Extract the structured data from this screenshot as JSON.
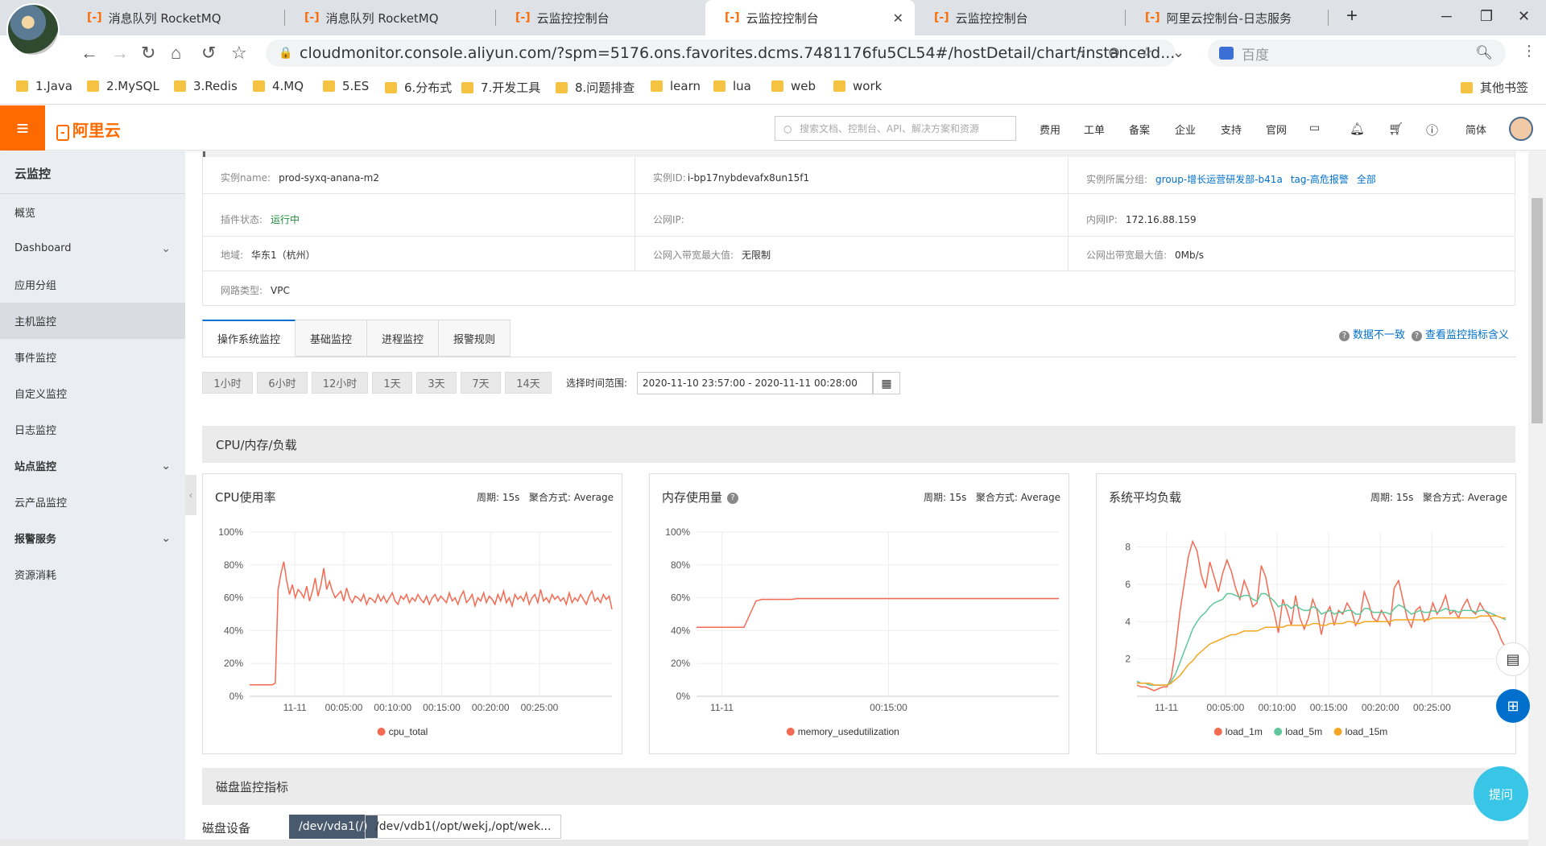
{
  "browser": {
    "tabs": [
      {
        "label": "消息队列 RocketMQ"
      },
      {
        "label": "消息队列 RocketMQ"
      },
      {
        "label": "云监控控制台"
      },
      {
        "label": "云监控控制台"
      },
      {
        "label": "云监控控制台"
      },
      {
        "label": "阿里云控制台-日志服务"
      }
    ],
    "new_tab": "+",
    "url": "cloudmonitor.console.aliyun.com/?spm=5176.ons.favorites.dcms.7481176fu5CL54#/hostDetail/chart/instanceId...",
    "search_placeholder": "百度",
    "bookmarks": [
      "1.Java",
      "2.MySQL",
      "3.Redis",
      "4.MQ",
      "5.ES",
      "6.分布式",
      "7.开发工具",
      "8.问题排查",
      "learn",
      "lua",
      "web",
      "work"
    ],
    "other_bookmarks": "其他书签"
  },
  "console": {
    "logo": "阿里云",
    "search_placeholder": "搜索文档、控制台、API、解决方案和资源",
    "nav": [
      "费用",
      "工单",
      "备案",
      "企业",
      "支持",
      "官网"
    ],
    "lang": "简体"
  },
  "sidebar": {
    "title": "云监控",
    "items": [
      {
        "label": "概览"
      },
      {
        "label": "Dashboard"
      },
      {
        "label": "应用分组"
      },
      {
        "label": "主机监控"
      },
      {
        "label": "事件监控"
      },
      {
        "label": "自定义监控"
      },
      {
        "label": "日志监控"
      },
      {
        "label": "站点监控"
      },
      {
        "label": "云产品监控"
      },
      {
        "label": "报警服务"
      },
      {
        "label": "资源消耗"
      }
    ]
  },
  "instance": {
    "name_key": "实例name:",
    "name": "prod-syxq-anana-m2",
    "id_key": "实例ID:",
    "id": "i-bp17nybdevafx8un15f1",
    "group_key": "实例所属分组:",
    "group1": "group-增长运营研发部-b41a",
    "group2": "tag-高危报警",
    "group_all": "全部",
    "agent_key": "插件状态:",
    "agent": "运行中",
    "pubip_key": "公网IP:",
    "privip_key": "内网IP:",
    "privip": "172.16.88.159",
    "region_key": "地域:",
    "region": "华东1（杭州）",
    "inbw_key": "公网入带宽最大值:",
    "inbw": "无限制",
    "outbw_key": "公网出带宽最大值:",
    "outbw": "0Mb/s",
    "net_key": "网路类型:",
    "net": "VPC"
  },
  "tabs": [
    "操作系统监控",
    "基础监控",
    "进程监控",
    "报警规则"
  ],
  "help_links": [
    "数据不一致",
    "查看监控指标含义"
  ],
  "time_buttons": [
    "1小时",
    "6小时",
    "12小时",
    "1天",
    "3天",
    "7天",
    "14天"
  ],
  "range_label": "选择时间范围:",
  "range_value": "2020-11-10 23:57:00 - 2020-11-11 00:28:00",
  "section_cpu": "CPU/内存/负载",
  "section_disk": "磁盘监控指标",
  "disk_label": "磁盘设备",
  "disk_tabs": [
    "/dev/vda1(/)",
    "/dev/vdb1(/opt/wekj,/opt/wek..."
  ],
  "float_ask": "提问",
  "colors": {
    "red": "#f46a52",
    "green": "#5fc79a",
    "orange": "#f5a623",
    "accent": "#ff6a00",
    "link": "#0070cc"
  },
  "chart_data": [
    {
      "type": "line",
      "title": "CPU使用率",
      "period": "周期: 15s",
      "agg": "聚合方式: Average",
      "y_ticks": [
        "100%",
        "80%",
        "60%",
        "40%",
        "20%",
        "0%"
      ],
      "x_ticks": [
        "11-11",
        "00:05:00",
        "00:10:00",
        "00:15:00",
        "00:20:00",
        "00:25:00"
      ],
      "ylim": [
        0,
        100
      ],
      "series": [
        {
          "name": "cpu_total",
          "color": "#f46a52",
          "values": [
            7,
            7,
            7,
            7,
            7,
            7,
            7,
            7,
            7,
            8,
            65,
            75,
            82,
            70,
            62,
            68,
            60,
            65,
            63,
            60,
            67,
            58,
            64,
            72,
            61,
            68,
            78,
            65,
            70,
            64,
            60,
            62,
            64,
            58,
            66,
            60,
            57,
            61,
            60,
            58,
            62,
            56,
            60,
            59,
            57,
            62,
            58,
            61,
            57,
            60,
            63,
            58,
            56,
            61,
            59,
            62,
            57,
            60,
            58,
            62,
            59,
            57,
            61,
            56,
            60,
            62,
            58,
            61,
            59,
            57,
            63,
            58,
            60,
            56,
            61,
            64,
            57,
            59,
            62,
            55,
            60,
            58,
            63,
            57,
            61,
            59,
            56,
            62,
            58,
            64,
            57,
            60,
            55,
            62,
            59,
            61,
            58,
            63,
            56,
            60,
            62,
            57,
            65,
            58,
            60,
            57,
            62,
            59,
            61,
            58,
            60,
            56,
            63,
            57,
            60,
            58,
            62,
            59,
            56,
            61,
            64,
            58,
            60,
            57,
            62,
            59,
            61,
            53
          ]
        }
      ]
    },
    {
      "type": "line",
      "title": "内存使用量",
      "period": "周期: 15s",
      "agg": "聚合方式: Average",
      "y_ticks": [
        "100%",
        "80%",
        "60%",
        "40%",
        "20%",
        "0%"
      ],
      "x_ticks": [
        "11-11",
        "00:15:00"
      ],
      "ylim": [
        0,
        100
      ],
      "series": [
        {
          "name": "memory_usedutilization",
          "color": "#f46a52",
          "values": [
            42,
            42,
            42,
            42,
            42,
            42,
            42,
            42,
            42,
            50,
            58,
            59,
            59,
            59,
            59,
            59,
            59,
            59.5,
            59.5,
            59.5,
            59.5,
            59.5,
            59.5,
            59.5,
            59.5,
            59.5,
            59.5,
            59.5,
            59.5,
            59.5,
            59.5,
            59.5,
            59.5,
            59.5,
            59.5,
            59.5,
            59.5,
            59.5,
            59.5,
            59.5,
            59.5,
            59.5,
            59.5,
            59.5,
            59.5,
            59.5,
            59.5,
            59.5,
            59.5,
            59.5,
            59.5,
            59.5,
            59.5,
            59.5,
            59.5,
            59.5,
            59.5,
            59.5,
            59.5,
            59.5,
            59.5,
            59.5
          ]
        }
      ]
    },
    {
      "type": "line",
      "title": "系统平均负载",
      "period": "周期: 15s",
      "agg": "聚合方式: Average",
      "y_ticks": [
        "8",
        "6",
        "4",
        "2"
      ],
      "x_ticks": [
        "11-11",
        "00:05:00",
        "00:10:00",
        "00:15:00",
        "00:20:00",
        "00:25:00"
      ],
      "ylim": [
        0,
        8.8
      ],
      "series": [
        {
          "name": "load_1m",
          "color": "#f46a52",
          "values": [
            0.6,
            0.5,
            0.5,
            0.4,
            0.3,
            0.4,
            0.5,
            0.5,
            1.0,
            2.5,
            4.5,
            6.0,
            7.5,
            8.3,
            7.8,
            6.5,
            5.8,
            7.2,
            6.4,
            5.6,
            6.6,
            7.3,
            6.7,
            5.8,
            5.2,
            6.2,
            5.6,
            4.8,
            5.0,
            7.0,
            6.4,
            5.2,
            4.5,
            3.4,
            5.2,
            4.6,
            3.8,
            5.4,
            4.2,
            3.6,
            4.2,
            5.2,
            4.6,
            3.3,
            4.4,
            4.8,
            3.8,
            4.6,
            4.4,
            5.0,
            4.6,
            3.8,
            4.2,
            5.6,
            5.0,
            4.2,
            4.0,
            4.6,
            4.2,
            3.8,
            5.8,
            6.2,
            5.2,
            4.2,
            3.7,
            4.6,
            4.8,
            4.0,
            4.2,
            5.0,
            4.4,
            4.8,
            5.4,
            4.4,
            4.6,
            4.2,
            4.8,
            5.2,
            4.6,
            4.4,
            5.0,
            4.6,
            4.4,
            4.0,
            3.6,
            3.0,
            2.6
          ]
        },
        {
          "name": "load_5m",
          "color": "#5fc79a",
          "values": [
            0.8,
            0.7,
            0.7,
            0.6,
            0.6,
            0.6,
            0.6,
            0.6,
            0.8,
            1.2,
            1.8,
            2.4,
            3.0,
            3.6,
            4.0,
            4.3,
            4.5,
            4.8,
            5.0,
            5.1,
            5.2,
            5.5,
            5.5,
            5.4,
            5.3,
            5.4,
            5.4,
            5.2,
            5.1,
            5.5,
            5.5,
            5.3,
            5.1,
            4.8,
            4.9,
            4.9,
            4.7,
            4.9,
            4.7,
            4.6,
            4.6,
            4.8,
            4.7,
            4.4,
            4.5,
            4.6,
            4.4,
            4.5,
            4.5,
            4.6,
            4.6,
            4.4,
            4.4,
            4.7,
            4.7,
            4.5,
            4.5,
            4.5,
            4.5,
            4.4,
            4.7,
            4.9,
            4.8,
            4.6,
            4.4,
            4.5,
            4.6,
            4.5,
            4.5,
            4.6,
            4.5,
            4.6,
            4.7,
            4.6,
            4.6,
            4.5,
            4.6,
            4.6,
            4.6,
            4.5,
            4.6,
            4.6,
            4.5,
            4.4,
            4.3,
            4.2,
            4.1
          ]
        },
        {
          "name": "load_15m",
          "color": "#f5a623",
          "values": [
            0.7,
            0.7,
            0.7,
            0.7,
            0.6,
            0.6,
            0.6,
            0.6,
            0.7,
            0.9,
            1.1,
            1.4,
            1.7,
            1.9,
            2.2,
            2.4,
            2.6,
            2.8,
            2.9,
            3.0,
            3.1,
            3.2,
            3.3,
            3.3,
            3.4,
            3.5,
            3.5,
            3.5,
            3.5,
            3.6,
            3.7,
            3.7,
            3.7,
            3.7,
            3.7,
            3.8,
            3.8,
            3.8,
            3.8,
            3.8,
            3.8,
            3.9,
            3.9,
            3.8,
            3.8,
            3.9,
            3.9,
            3.9,
            3.9,
            4.0,
            4.0,
            3.9,
            3.9,
            4.0,
            4.0,
            4.0,
            4.0,
            4.0,
            4.0,
            4.0,
            4.1,
            4.1,
            4.1,
            4.1,
            4.1,
            4.1,
            4.1,
            4.1,
            4.1,
            4.2,
            4.2,
            4.2,
            4.2,
            4.2,
            4.2,
            4.2,
            4.2,
            4.2,
            4.2,
            4.2,
            4.3,
            4.3,
            4.3,
            4.3,
            4.3,
            4.2,
            4.2
          ]
        }
      ]
    }
  ]
}
